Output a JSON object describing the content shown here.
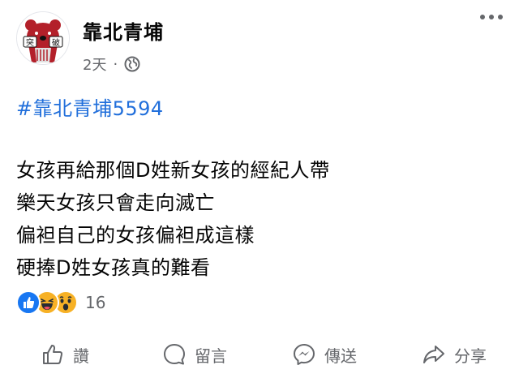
{
  "post": {
    "author": "靠北青埔",
    "avatar": {
      "text_left": "突",
      "text_right": "破"
    },
    "time": "2天",
    "separator": "·",
    "privacy_icon": "globe-icon",
    "hashtag": "#靠北青埔5594",
    "lines": [
      "女孩再給那個D姓新女孩的經紀人帶",
      "樂天女孩只會走向滅亡",
      "偏袒自己的女孩偏袒成這樣",
      "硬捧D姓女孩真的難看"
    ],
    "reactions": {
      "icons": [
        "like-icon",
        "haha-icon",
        "wow-icon"
      ],
      "count": "16"
    }
  },
  "actions": {
    "like": "讚",
    "comment": "留言",
    "share_messenger": "傳送",
    "share": "分享"
  },
  "colors": {
    "link": "#216fdb",
    "muted": "#65676b",
    "like_blue": "#1877f2",
    "emoji_yellow": "#f7b125",
    "avatar_red": "#b3202a"
  }
}
